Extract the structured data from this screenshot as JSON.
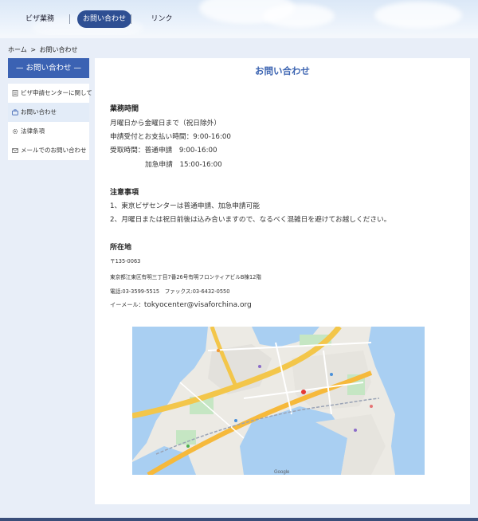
{
  "nav": {
    "items": [
      {
        "label": "ビザ業務",
        "active": false
      },
      {
        "label": "お問い合わせ",
        "active": true
      },
      {
        "label": "リンク",
        "active": false
      }
    ]
  },
  "breadcrumb": {
    "home": "ホーム",
    "separator": ">",
    "current": "お問い合わせ"
  },
  "sidebar": {
    "header": "— お問い合わせ —",
    "items": [
      {
        "label": "ビザ申請センターに関して",
        "icon": "document-icon"
      },
      {
        "label": "お問い合わせ",
        "icon": "briefcase-icon",
        "active": true
      },
      {
        "label": "法律条項",
        "icon": "gear-icon"
      },
      {
        "label": "メールでのお問い合わせ",
        "icon": "mail-icon"
      }
    ]
  },
  "main": {
    "title": "お問い合わせ",
    "hours": {
      "heading": "業務時間",
      "line1": "月曜日から金曜日まで（祝日除外）",
      "line2": "申請受付とお支払い時間：9:00-16:00",
      "line3": "受取時間：普通申請　9:00-16:00",
      "line4": "加急申請　15:00-16:00"
    },
    "notes": {
      "heading": "注意事項",
      "line1": "1、東京ビザセンターは普通申請、加急申請可能",
      "line2": "2、月曜日または祝日前後は込み合いますので、なるべく混雑日を避けてお越しください。"
    },
    "location": {
      "heading": "所在地",
      "postal": "〒135-0063",
      "address": "東京都江東区有明三丁目7番26号有明フロンティアビルB棟12階",
      "phone": "電話:03-3599-5515　ファックス:03-6432-0550",
      "email_label": "イーメール：",
      "email": "tokyocenter@visaforchina.org"
    },
    "map": {
      "attribution": "Google"
    }
  },
  "colors": {
    "accent": "#3b62b3",
    "nav_active": "#2e4f93",
    "title": "#3c64b1",
    "footer": "#3a4e7a"
  }
}
